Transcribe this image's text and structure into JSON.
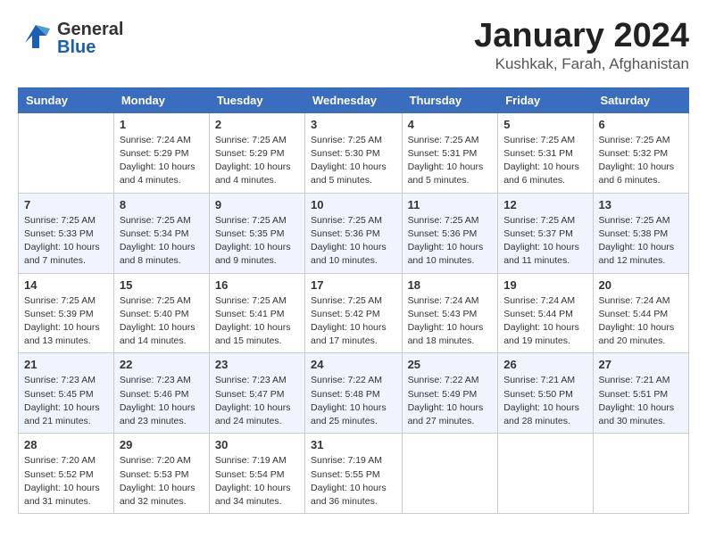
{
  "header": {
    "logo_general": "General",
    "logo_blue": "Blue",
    "month_title": "January 2024",
    "location": "Kushkak, Farah, Afghanistan"
  },
  "weekdays": [
    "Sunday",
    "Monday",
    "Tuesday",
    "Wednesday",
    "Thursday",
    "Friday",
    "Saturday"
  ],
  "weeks": [
    [
      {
        "day": "",
        "info": ""
      },
      {
        "day": "1",
        "info": "Sunrise: 7:24 AM\nSunset: 5:29 PM\nDaylight: 10 hours\nand 4 minutes."
      },
      {
        "day": "2",
        "info": "Sunrise: 7:25 AM\nSunset: 5:29 PM\nDaylight: 10 hours\nand 4 minutes."
      },
      {
        "day": "3",
        "info": "Sunrise: 7:25 AM\nSunset: 5:30 PM\nDaylight: 10 hours\nand 5 minutes."
      },
      {
        "day": "4",
        "info": "Sunrise: 7:25 AM\nSunset: 5:31 PM\nDaylight: 10 hours\nand 5 minutes."
      },
      {
        "day": "5",
        "info": "Sunrise: 7:25 AM\nSunset: 5:31 PM\nDaylight: 10 hours\nand 6 minutes."
      },
      {
        "day": "6",
        "info": "Sunrise: 7:25 AM\nSunset: 5:32 PM\nDaylight: 10 hours\nand 6 minutes."
      }
    ],
    [
      {
        "day": "7",
        "info": "Sunrise: 7:25 AM\nSunset: 5:33 PM\nDaylight: 10 hours\nand 7 minutes."
      },
      {
        "day": "8",
        "info": "Sunrise: 7:25 AM\nSunset: 5:34 PM\nDaylight: 10 hours\nand 8 minutes."
      },
      {
        "day": "9",
        "info": "Sunrise: 7:25 AM\nSunset: 5:35 PM\nDaylight: 10 hours\nand 9 minutes."
      },
      {
        "day": "10",
        "info": "Sunrise: 7:25 AM\nSunset: 5:36 PM\nDaylight: 10 hours\nand 10 minutes."
      },
      {
        "day": "11",
        "info": "Sunrise: 7:25 AM\nSunset: 5:36 PM\nDaylight: 10 hours\nand 10 minutes."
      },
      {
        "day": "12",
        "info": "Sunrise: 7:25 AM\nSunset: 5:37 PM\nDaylight: 10 hours\nand 11 minutes."
      },
      {
        "day": "13",
        "info": "Sunrise: 7:25 AM\nSunset: 5:38 PM\nDaylight: 10 hours\nand 12 minutes."
      }
    ],
    [
      {
        "day": "14",
        "info": "Sunrise: 7:25 AM\nSunset: 5:39 PM\nDaylight: 10 hours\nand 13 minutes."
      },
      {
        "day": "15",
        "info": "Sunrise: 7:25 AM\nSunset: 5:40 PM\nDaylight: 10 hours\nand 14 minutes."
      },
      {
        "day": "16",
        "info": "Sunrise: 7:25 AM\nSunset: 5:41 PM\nDaylight: 10 hours\nand 15 minutes."
      },
      {
        "day": "17",
        "info": "Sunrise: 7:25 AM\nSunset: 5:42 PM\nDaylight: 10 hours\nand 17 minutes."
      },
      {
        "day": "18",
        "info": "Sunrise: 7:24 AM\nSunset: 5:43 PM\nDaylight: 10 hours\nand 18 minutes."
      },
      {
        "day": "19",
        "info": "Sunrise: 7:24 AM\nSunset: 5:44 PM\nDaylight: 10 hours\nand 19 minutes."
      },
      {
        "day": "20",
        "info": "Sunrise: 7:24 AM\nSunset: 5:44 PM\nDaylight: 10 hours\nand 20 minutes."
      }
    ],
    [
      {
        "day": "21",
        "info": "Sunrise: 7:23 AM\nSunset: 5:45 PM\nDaylight: 10 hours\nand 21 minutes."
      },
      {
        "day": "22",
        "info": "Sunrise: 7:23 AM\nSunset: 5:46 PM\nDaylight: 10 hours\nand 23 minutes."
      },
      {
        "day": "23",
        "info": "Sunrise: 7:23 AM\nSunset: 5:47 PM\nDaylight: 10 hours\nand 24 minutes."
      },
      {
        "day": "24",
        "info": "Sunrise: 7:22 AM\nSunset: 5:48 PM\nDaylight: 10 hours\nand 25 minutes."
      },
      {
        "day": "25",
        "info": "Sunrise: 7:22 AM\nSunset: 5:49 PM\nDaylight: 10 hours\nand 27 minutes."
      },
      {
        "day": "26",
        "info": "Sunrise: 7:21 AM\nSunset: 5:50 PM\nDaylight: 10 hours\nand 28 minutes."
      },
      {
        "day": "27",
        "info": "Sunrise: 7:21 AM\nSunset: 5:51 PM\nDaylight: 10 hours\nand 30 minutes."
      }
    ],
    [
      {
        "day": "28",
        "info": "Sunrise: 7:20 AM\nSunset: 5:52 PM\nDaylight: 10 hours\nand 31 minutes."
      },
      {
        "day": "29",
        "info": "Sunrise: 7:20 AM\nSunset: 5:53 PM\nDaylight: 10 hours\nand 32 minutes."
      },
      {
        "day": "30",
        "info": "Sunrise: 7:19 AM\nSunset: 5:54 PM\nDaylight: 10 hours\nand 34 minutes."
      },
      {
        "day": "31",
        "info": "Sunrise: 7:19 AM\nSunset: 5:55 PM\nDaylight: 10 hours\nand 36 minutes."
      },
      {
        "day": "",
        "info": ""
      },
      {
        "day": "",
        "info": ""
      },
      {
        "day": "",
        "info": ""
      }
    ]
  ]
}
